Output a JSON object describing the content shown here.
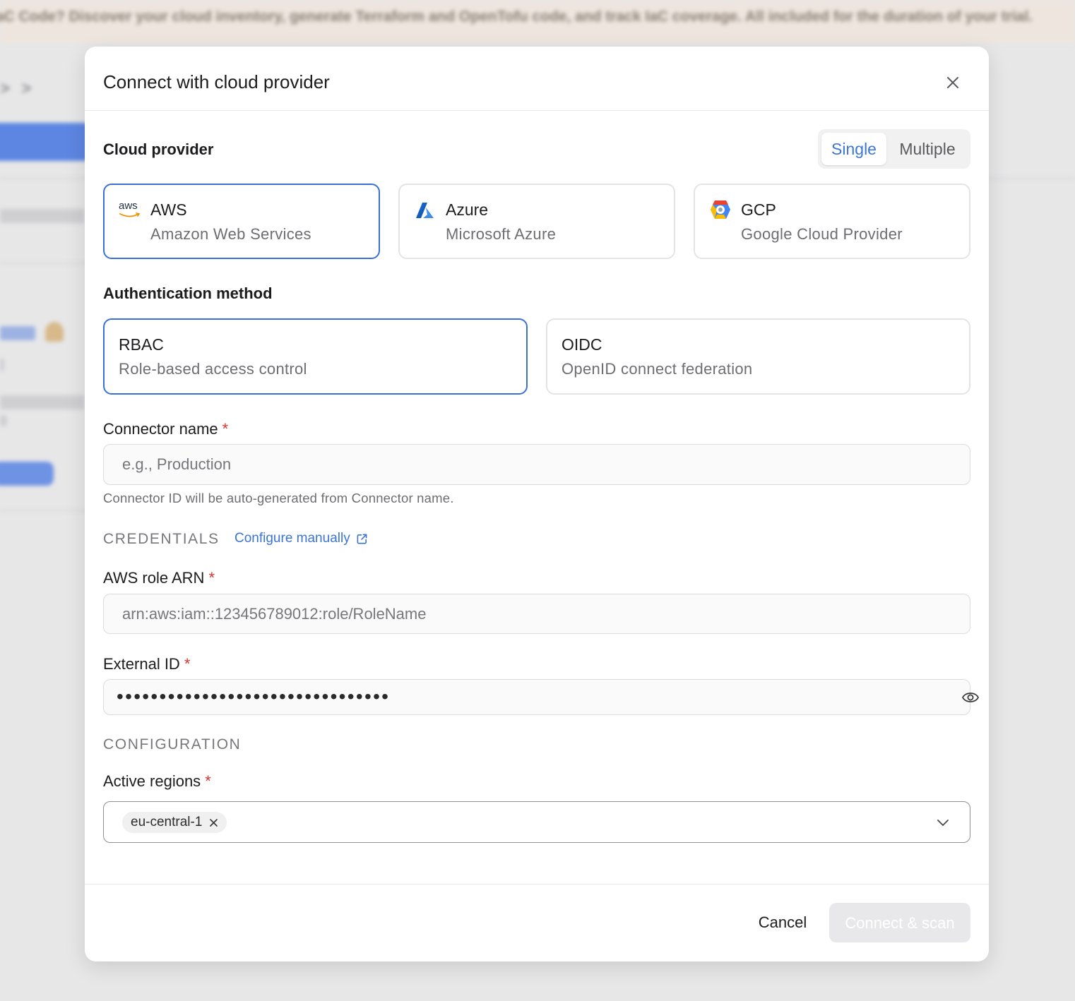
{
  "background": {
    "banner_text": "IaC Code? Discover your cloud inventory, generate Terraform and OpenTofu code, and track IaC coverage. All included for the duration of your trial."
  },
  "modal": {
    "title": "Connect with cloud provider",
    "cloud_provider": {
      "label": "Cloud provider",
      "mode_toggle": {
        "options": [
          "Single",
          "Multiple"
        ],
        "selected": "Single"
      },
      "providers": [
        {
          "logo_text": "aws",
          "name": "AWS",
          "description": "Amazon Web Services",
          "selected": true
        },
        {
          "logo_text": "",
          "name": "Azure",
          "description": "Microsoft Azure",
          "selected": false
        },
        {
          "logo_text": "",
          "name": "GCP",
          "description": "Google Cloud Provider",
          "selected": false
        }
      ]
    },
    "authentication": {
      "label": "Authentication method",
      "methods": [
        {
          "name": "RBAC",
          "description": "Role-based access control",
          "selected": true
        },
        {
          "name": "OIDC",
          "description": "OpenID connect federation",
          "selected": false
        }
      ]
    },
    "connector_name": {
      "label": "Connector name",
      "required_mark": "*",
      "value": "",
      "placeholder": "e.g., Production",
      "helper": "Connector ID will be auto-generated from Connector name."
    },
    "credentials": {
      "heading": "CREDENTIALS",
      "configure_link": "Configure manually",
      "role_arn": {
        "label": "AWS role ARN",
        "required_mark": "*",
        "value": "",
        "placeholder": "arn:aws:iam::123456789012:role/RoleName"
      },
      "external_id": {
        "label": "External ID",
        "required_mark": "*",
        "masked_value": "••••••••••••••••••••••••••••••••"
      }
    },
    "configuration": {
      "heading": "CONFIGURATION",
      "active_regions": {
        "label": "Active regions",
        "required_mark": "*",
        "selected": [
          "eu-central-1"
        ]
      }
    },
    "footer": {
      "cancel_label": "Cancel",
      "primary_label": "Connect & scan",
      "primary_disabled": true
    }
  },
  "colors": {
    "accent": "#3a70d6",
    "required": "#d6352c",
    "disabled_button": "#e8e8ea"
  }
}
